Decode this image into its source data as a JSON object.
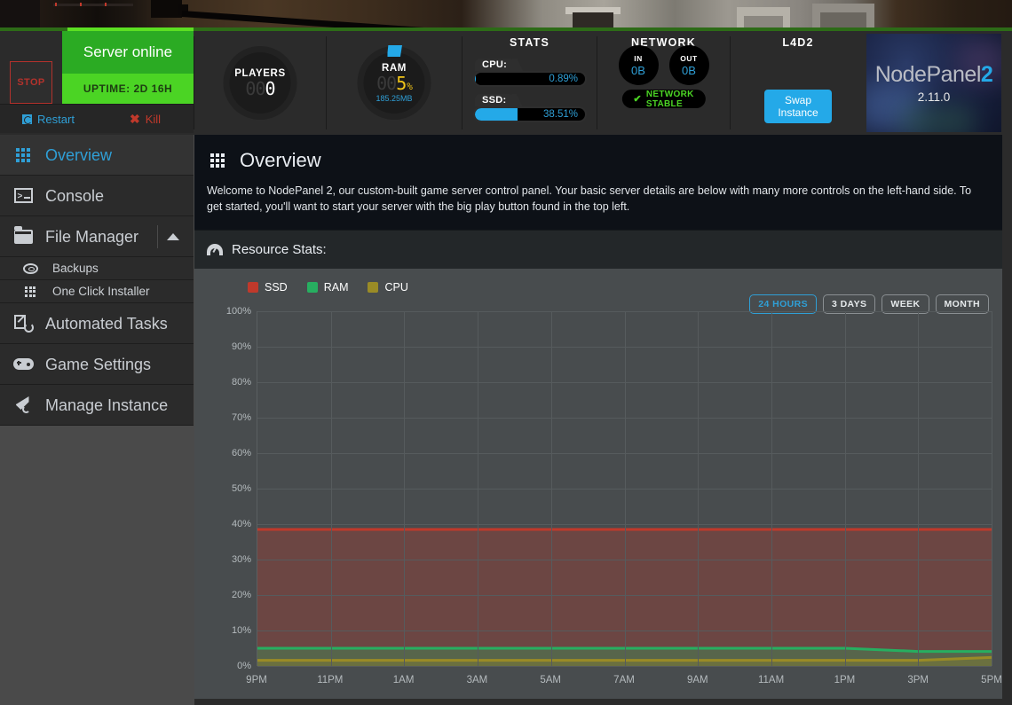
{
  "control_bar": {
    "stop_button": "STOP",
    "status": "Server online",
    "uptime": "UPTIME: 2D 16H",
    "restart": "Restart",
    "kill": "Kill",
    "players": {
      "title": "PLAYERS",
      "dim_digits": "00",
      "value": "0"
    },
    "ram": {
      "title": "RAM",
      "dim_digits": "00",
      "value": "5",
      "unit": "%",
      "sub": "185.25MB"
    },
    "stats": {
      "title": "STATS",
      "cpu_label": "CPU:",
      "cpu_value": "0.89%",
      "cpu_pct": 0.89,
      "ssd_label": "SSD:",
      "ssd_value": "38.51%",
      "ssd_pct": 38.51
    },
    "network": {
      "title": "NETWORK",
      "in_label": "IN",
      "in_value": "0B",
      "out_label": "OUT",
      "out_value": "0B",
      "status": "NETWORK STABLE"
    },
    "game": {
      "title": "L4D2",
      "swap_button": "Swap Instance"
    },
    "brand": {
      "name_part1": "NodePanel",
      "name_part2": "2",
      "version": "2.11.0"
    }
  },
  "sidebar": {
    "items": [
      {
        "label": "Overview",
        "icon": "grid-icon",
        "active": true
      },
      {
        "label": "Console",
        "icon": "terminal-icon",
        "active": false
      },
      {
        "label": "File Manager",
        "icon": "folder-icon",
        "active": false,
        "expanded": true
      },
      {
        "label": "Backups",
        "icon": "disc-icon",
        "sub": true
      },
      {
        "label": "One Click Installer",
        "icon": "grid-icon",
        "sub": true
      },
      {
        "label": "Automated Tasks",
        "icon": "tasks-icon",
        "active": false
      },
      {
        "label": "Game Settings",
        "icon": "gamepad-icon",
        "active": false
      },
      {
        "label": "Manage Instance",
        "icon": "rocket-icon",
        "active": false
      }
    ]
  },
  "main": {
    "page_title": "Overview",
    "description": "Welcome to NodePanel 2, our custom-built game server control panel. Your basic server details are below with many more controls on the left-hand side. To get started, you'll want to start your server with the big play button found in the top left.",
    "help_icon": "?",
    "resource_stats_label": "Resource Stats:",
    "ranges": [
      {
        "label": "24 HOURS",
        "active": true
      },
      {
        "label": "3 DAYS",
        "active": false
      },
      {
        "label": "WEEK",
        "active": false
      },
      {
        "label": "MONTH",
        "active": false
      }
    ]
  },
  "colors": {
    "ssd": "#c0392b",
    "ram": "#27ae60",
    "cpu": "#9a8b26",
    "accent": "#24a9e8",
    "online": "#2bab23"
  },
  "chart_data": {
    "type": "area",
    "title": "Resource Stats",
    "xlabel": "",
    "ylabel": "%",
    "ylim": [
      0,
      100
    ],
    "ytick_labels": [
      "0%",
      "10%",
      "20%",
      "30%",
      "40%",
      "50%",
      "60%",
      "70%",
      "80%",
      "90%",
      "100%"
    ],
    "yticks": [
      0,
      10,
      20,
      30,
      40,
      50,
      60,
      70,
      80,
      90,
      100
    ],
    "x": [
      "9PM",
      "11PM",
      "1AM",
      "3AM",
      "5AM",
      "7AM",
      "9AM",
      "11AM",
      "1PM",
      "3PM",
      "5PM"
    ],
    "grid": true,
    "legend_position": "top-left",
    "series": [
      {
        "name": "SSD",
        "color": "#c0392b",
        "values": [
          38.5,
          38.5,
          38.5,
          38.5,
          38.5,
          38.5,
          38.5,
          38.5,
          38.5,
          38.5,
          38.5
        ]
      },
      {
        "name": "RAM",
        "color": "#27ae60",
        "values": [
          5.0,
          5.0,
          5.0,
          5.0,
          5.0,
          5.0,
          5.0,
          5.0,
          5.0,
          4.1,
          4.1
        ]
      },
      {
        "name": "CPU",
        "color": "#9a8b26",
        "values": [
          1.6,
          1.6,
          1.6,
          1.6,
          1.6,
          1.6,
          1.6,
          1.6,
          1.6,
          1.6,
          2.4
        ]
      }
    ]
  }
}
